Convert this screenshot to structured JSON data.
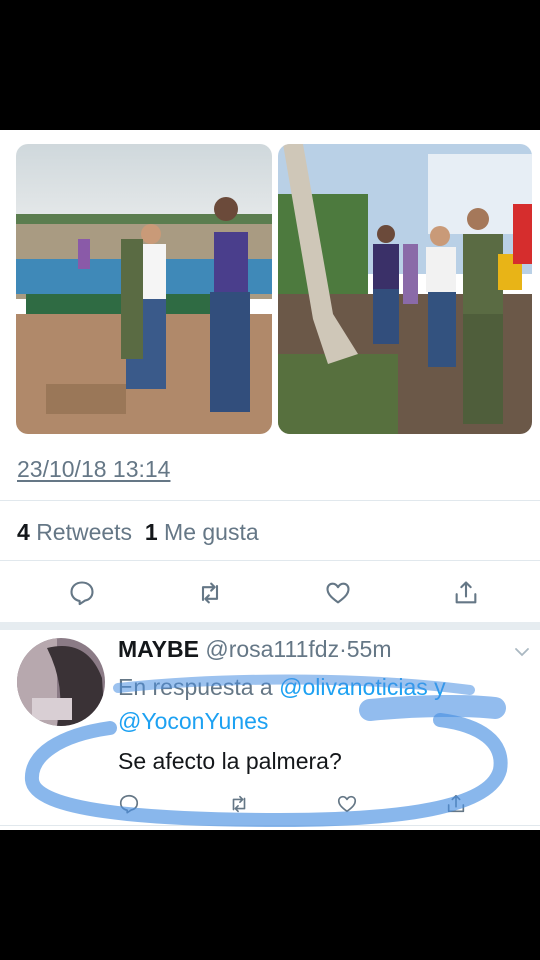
{
  "tweet": {
    "timestamp": "23/10/18 13:14",
    "retweet_count": "4",
    "retweet_label": "Retweets",
    "like_count": "1",
    "like_label": "Me gusta",
    "actions": [
      "reply-icon",
      "retweet-icon",
      "heart-icon",
      "share-icon"
    ]
  },
  "reply": {
    "name": "MAYBE",
    "handle": "@rosa111fdz",
    "separator": "·",
    "time": "55m",
    "reply_prefix": "En respuesta a",
    "mention1": "@olivanoticias",
    "conjunction": "y",
    "mention2": "@YoconYunes",
    "text": "Se afecto la palmera?"
  },
  "colors": {
    "link": "#1da1f2",
    "muted": "#657786",
    "annotation": "#4a90e2"
  }
}
